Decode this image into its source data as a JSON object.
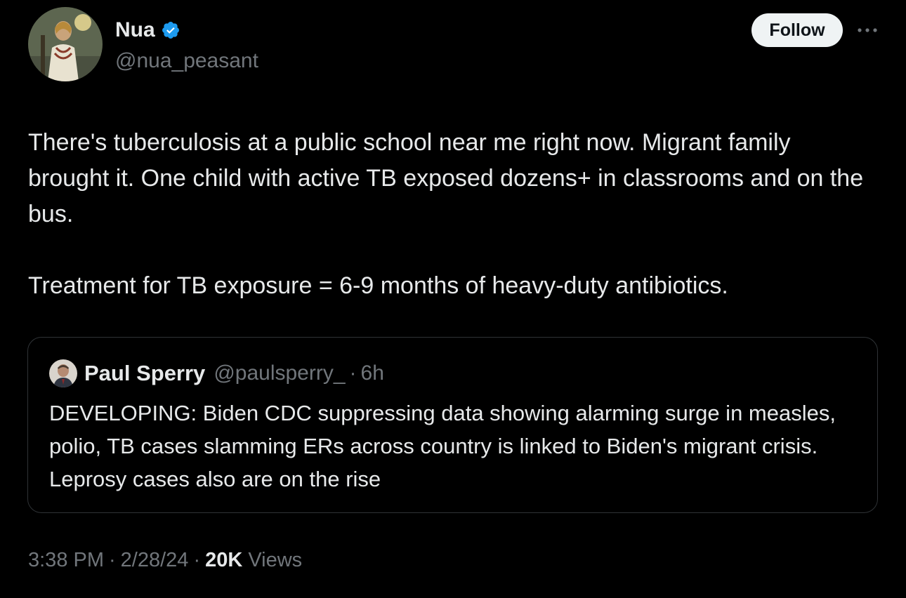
{
  "author": {
    "display_name": "Nua",
    "handle": "@nua_peasant",
    "verified": true,
    "avatar_icon": "profile-avatar-icon"
  },
  "actions": {
    "follow_label": "Follow",
    "more_icon": "more-horizontal-icon"
  },
  "tweet": {
    "paragraphs": [
      "There's tuberculosis at a public school near me right now. Migrant family brought it. One child with active TB exposed dozens+ in classrooms and on the bus.",
      "Treatment for TB exposure = 6-9 months of heavy-duty antibiotics."
    ]
  },
  "quote": {
    "display_name": "Paul Sperry",
    "handle": "@paulsperry_",
    "separator": "·",
    "time": "6h",
    "text": "DEVELOPING: Biden CDC suppressing data showing alarming surge in measles, polio, TB cases slamming ERs across country is linked to Biden's migrant crisis. Leprosy cases also are on the rise"
  },
  "meta": {
    "time": "3:38 PM",
    "date": "2/28/24",
    "separator": "·",
    "views_count": "20K",
    "views_label": "Views"
  },
  "colors": {
    "background": "#000000",
    "text": "#e7e9ea",
    "muted": "#71767b",
    "verified_badge": "#1d9bf0",
    "border": "#2f3336",
    "follow_bg": "#eff3f4"
  }
}
